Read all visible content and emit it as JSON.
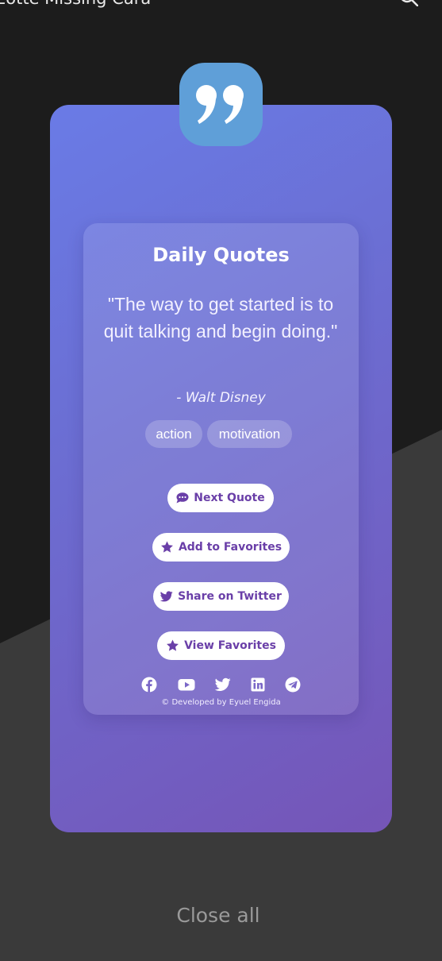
{
  "status_bar": {
    "title": "Eotte Missing Cara",
    "search_icon": "search-icon"
  },
  "card": {
    "badge_icon": "quote-icon",
    "title": "Daily Quotes",
    "quote": "\"The way to get started is to quit talking and begin doing.\"",
    "author": "- Walt Disney",
    "tags": [
      "action",
      "motivation"
    ],
    "buttons": {
      "next": "Next Quote",
      "favorite": "Add to Favorites",
      "share": "Share on Twitter",
      "view": "View Favorites"
    },
    "socials": [
      "facebook-icon",
      "youtube-icon",
      "twitter-icon",
      "linkedin-icon",
      "telegram-icon"
    ],
    "footer": "© Developed by Eyuel Engida"
  },
  "close_all": "Close all",
  "colors": {
    "card_gradient_start": "#6a7be6",
    "card_gradient_end": "#7555b7",
    "badge": "#5f9fd8",
    "button_text": "#6a3fa8"
  }
}
